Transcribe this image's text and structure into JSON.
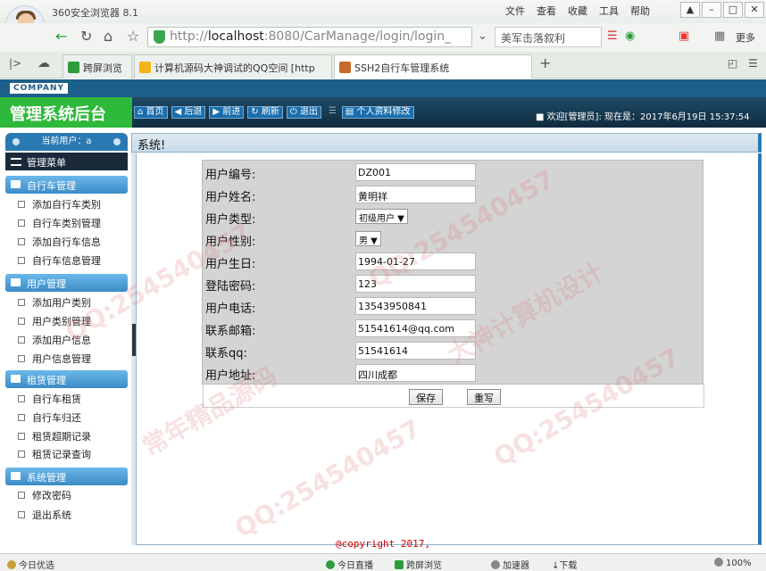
{
  "browser": {
    "app_name": "360安全浏览器 8.1",
    "menu": [
      "文件",
      "查看",
      "收藏",
      "工具",
      "帮助"
    ],
    "url_prefix": "http://",
    "url_host": "localhost",
    "url_rest": ":8080/CarManage/login/login_",
    "search_text": "美军击落叙利",
    "more_label": "更多",
    "tabs": [
      {
        "label": "跨屏浏览",
        "active": false
      },
      {
        "label": "计算机源码大神调试的QQ空间 [http",
        "active": false
      },
      {
        "label": "SSH2自行车管理系统",
        "active": true
      }
    ],
    "statusbar": [
      "今日优选",
      "今日直播",
      "跨屏浏览",
      "加速器",
      "下载",
      "100%"
    ]
  },
  "header": {
    "company": "COMPANY",
    "system_name": "管理系统后台",
    "buttons": [
      "首页",
      "后退",
      "前进",
      "刷新",
      "退出",
      "个人资料修改"
    ],
    "welcome": "欢迎[管理员]:   现在是：2017年6月19日 15:37:54"
  },
  "sidebar": {
    "current_user": "当前用户：a",
    "menu_title": "管理菜单",
    "groups": [
      {
        "title": "自行车管理",
        "items": [
          "添加自行车类别",
          "自行车类别管理",
          "添加自行车信息",
          "自行车信息管理"
        ]
      },
      {
        "title": "用户管理",
        "items": [
          "添加用户类别",
          "用户类别管理",
          "添加用户信息",
          "用户信息管理"
        ]
      },
      {
        "title": "租赁管理",
        "items": [
          "自行车租赁",
          "自行车归还",
          "租赁超期记录",
          "租赁记录查询"
        ]
      },
      {
        "title": "系统管理",
        "items": [
          "修改密码",
          "退出系统"
        ]
      }
    ]
  },
  "panel": {
    "title": "系统!"
  },
  "form": {
    "fields": [
      {
        "label": "用户编号:",
        "value": "DZ001",
        "type": "input"
      },
      {
        "label": "用户姓名:",
        "value": "黄明祥",
        "type": "input"
      },
      {
        "label": "用户类型:",
        "value": "初级用户",
        "type": "select"
      },
      {
        "label": "用户性别:",
        "value": "男",
        "type": "select"
      },
      {
        "label": "用户生日:",
        "value": "1994-01-27",
        "type": "input"
      },
      {
        "label": "登陆密码:",
        "value": "123",
        "type": "input"
      },
      {
        "label": "用户电话:",
        "value": "13543950841",
        "type": "input"
      },
      {
        "label": "联系邮箱:",
        "value": "51541614@qq.com",
        "type": "input"
      },
      {
        "label": "联系qq:",
        "value": "51541614",
        "type": "input"
      },
      {
        "label": "用户地址:",
        "value": "四川成都",
        "type": "input"
      }
    ],
    "save_label": "保存",
    "reset_label": "重写"
  },
  "footer": {
    "copyright": "@copyright 2017,"
  },
  "watermarks": [
    "QQ:254540457",
    "大神计算机设计",
    "常年精品源码"
  ],
  "colors": {
    "header_dark": "#1d5f8b",
    "system_name_bg": "#2fb93a",
    "sidebar_group": "#3b8bc7",
    "form_bg": "#d4d4d4"
  }
}
